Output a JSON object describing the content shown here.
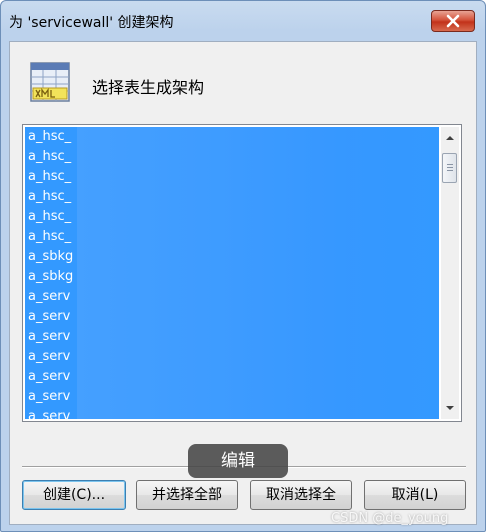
{
  "window": {
    "title": "为 'servicewall' 创建架构"
  },
  "header": {
    "text": "选择表生成架构",
    "icon": "xml-table-icon"
  },
  "list": {
    "items": [
      "a_hsc_",
      "a_hsc_",
      "a_hsc_",
      "a_hsc_",
      "a_hsc_",
      "a_hsc_",
      "a_sbkg",
      "a_sbkg",
      "a_serv",
      "a_serv",
      "a_serv",
      "a_serv",
      "a_serv",
      "a_serv",
      "a_serv"
    ],
    "selection_color": "#3399ff"
  },
  "tooltip": {
    "text": "编辑"
  },
  "buttons": {
    "create": "创建(C)...",
    "select_all": "并选择全部",
    "deselect_all": "取消选择全",
    "cancel": "取消(L)"
  },
  "watermark": "CSDN @de_young"
}
